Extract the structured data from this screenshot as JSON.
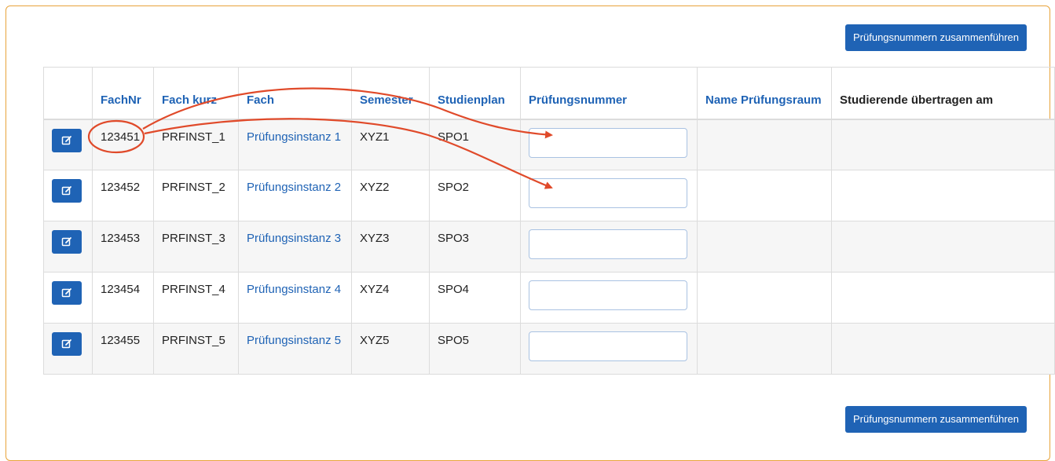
{
  "merge_button_label": "Prüfungsnummern zusammenführen",
  "columns": {
    "fachnr": "FachNr",
    "fach_kurz": "Fach kurz",
    "fach": "Fach",
    "semester": "Semester",
    "studienplan": "Studienplan",
    "pruefungsnummer": "Prüfungsnummer",
    "name_pruefungsraum": "Name Prüfungsraum",
    "uebertragen": "Studierende übertragen am"
  },
  "rows": [
    {
      "fachnr": "123451",
      "fach_kurz": "PRFINST_1",
      "fach": "Prüfungsinstanz 1",
      "semester": "XYZ1",
      "studienplan": "SPO1",
      "pruefungsnummer": "",
      "name_pruefungsraum": "",
      "uebertragen": ""
    },
    {
      "fachnr": "123452",
      "fach_kurz": "PRFINST_2",
      "fach": "Prüfungsinstanz 2",
      "semester": "XYZ2",
      "studienplan": "SPO2",
      "pruefungsnummer": "",
      "name_pruefungsraum": "",
      "uebertragen": ""
    },
    {
      "fachnr": "123453",
      "fach_kurz": "PRFINST_3",
      "fach": "Prüfungsinstanz 3",
      "semester": "XYZ3",
      "studienplan": "SPO3",
      "pruefungsnummer": "",
      "name_pruefungsraum": "",
      "uebertragen": ""
    },
    {
      "fachnr": "123454",
      "fach_kurz": "PRFINST_4",
      "fach": "Prüfungsinstanz 4",
      "semester": "XYZ4",
      "studienplan": "SPO4",
      "pruefungsnummer": "",
      "name_pruefungsraum": "",
      "uebertragen": ""
    },
    {
      "fachnr": "123455",
      "fach_kurz": "PRFINST_5",
      "fach": "Prüfungsinstanz 5",
      "semester": "XYZ5",
      "studienplan": "SPO5",
      "pruefungsnummer": "",
      "name_pruefungsraum": "",
      "uebertragen": ""
    }
  ],
  "icons": {
    "edit": "edit-icon"
  },
  "colors": {
    "primary": "#1f63b5",
    "panel_border": "#e8a33a",
    "annotation": "#e04a2a"
  }
}
